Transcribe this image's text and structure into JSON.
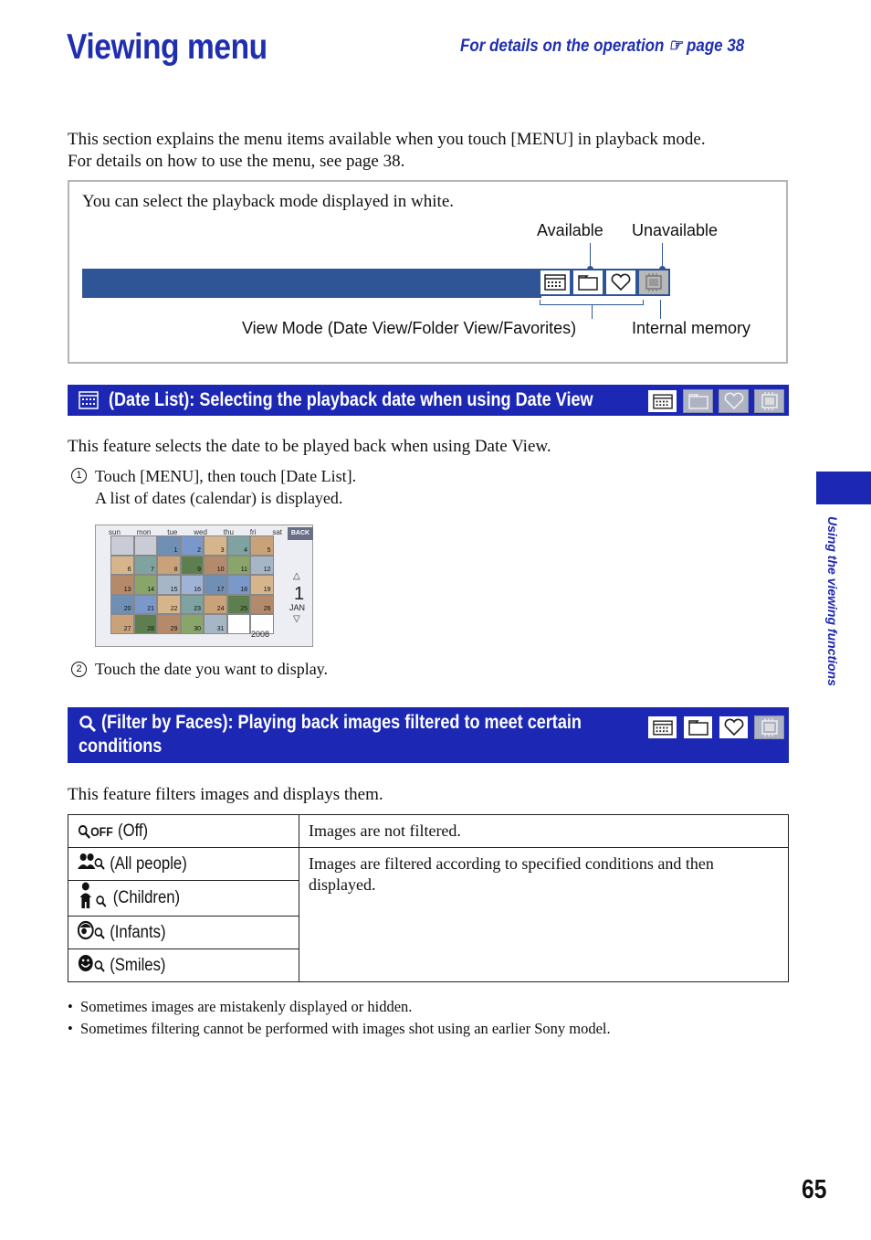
{
  "page": {
    "title": "Viewing menu",
    "operation_ref": "For details on the operation ☞ page 38",
    "intro": [
      "This section explains the menu items available when you touch [MENU] in playback mode.",
      "For details on how to use the menu, see page 38."
    ],
    "page_number": "65",
    "side_tab": "Using the viewing functions"
  },
  "infobox": {
    "text": "You can select the playback mode displayed in white.",
    "label_available": "Available",
    "label_unavailable": "Unavailable",
    "label_view_mode": "View Mode (Date View/Folder View/Favorites)",
    "label_internal": "Internal memory",
    "icons": [
      "date-view-icon",
      "folder-view-icon",
      "favorites-icon",
      "internal-memory-icon"
    ],
    "colors": {
      "bar": "#2f5597",
      "unavailable": "#b8b8b8"
    }
  },
  "date_list": {
    "header": "(Date List): Selecting the playback date when using Date View",
    "mode_icons": [
      {
        "icon": "date-view-icon",
        "available": true
      },
      {
        "icon": "folder-view-icon",
        "available": false
      },
      {
        "icon": "favorites-icon",
        "available": false
      },
      {
        "icon": "internal-memory-icon",
        "available": false
      }
    ],
    "description": "This feature selects the date to be played back when using Date View.",
    "step1_num": "1",
    "step1": "Touch [MENU], then touch [Date List].",
    "step1_sub": "A list of dates (calendar) is displayed.",
    "step2_num": "2",
    "step2": "Touch the date you want to display.",
    "calendar": {
      "weekdays": [
        "sun",
        "mon",
        "tue",
        "wed",
        "thu",
        "fri",
        "sat"
      ],
      "back_label": "BACK",
      "month_day": "1",
      "month": "JAN",
      "year": "2008",
      "up_arrow": "△",
      "down_arrow": "▽",
      "weeks": [
        [
          "",
          "",
          "1",
          "2",
          "3",
          "4",
          "5"
        ],
        [
          "6",
          "7",
          "8",
          "9",
          "10",
          "11",
          "12"
        ],
        [
          "13",
          "14",
          "15",
          "16",
          "17",
          "18",
          "19"
        ],
        [
          "20",
          "21",
          "22",
          "23",
          "24",
          "25",
          "26"
        ],
        [
          "27",
          "28",
          "29",
          "30",
          "31",
          "",
          ""
        ]
      ]
    }
  },
  "filter_faces": {
    "header_line1": "(Filter by Faces): Playing back images filtered to meet certain",
    "header_line2": "conditions",
    "mode_icons": [
      {
        "icon": "date-view-icon",
        "available": true
      },
      {
        "icon": "folder-view-icon",
        "available": true
      },
      {
        "icon": "favorites-icon",
        "available": true
      },
      {
        "icon": "internal-memory-icon",
        "available": false
      }
    ],
    "description": "This feature filters images and displays them.",
    "table": [
      {
        "icon": "face-off-icon",
        "icon_text": "OFF",
        "label": "(Off)",
        "desc": "Images are not filtered."
      },
      {
        "icon": "all-people-icon",
        "label": "(All people)",
        "desc": "Images are filtered according to specified conditions and then displayed."
      },
      {
        "icon": "children-icon",
        "label": "(Children)"
      },
      {
        "icon": "infants-icon",
        "label": "(Infants)"
      },
      {
        "icon": "smiles-icon",
        "label": "(Smiles)"
      }
    ],
    "notes": [
      "Sometimes images are mistakenly displayed or hidden.",
      "Sometimes filtering cannot be performed with images shot using an earlier Sony model."
    ]
  }
}
